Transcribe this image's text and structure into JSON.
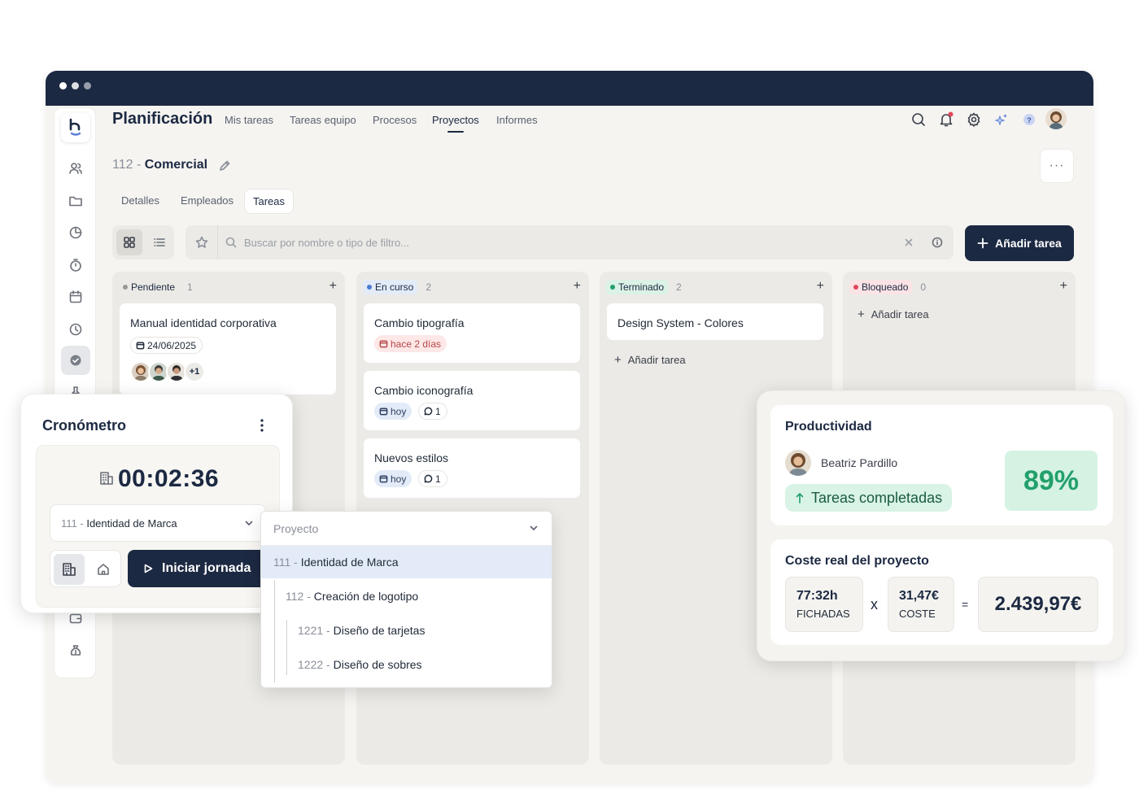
{
  "header": {
    "app_title": "Planificación",
    "nav": [
      "Mis tareas",
      "Tareas equipo",
      "Procesos",
      "Proyectos",
      "Informes"
    ],
    "active_nav": "Proyectos"
  },
  "project": {
    "number": "112",
    "separator": " - ",
    "name": "Comercial",
    "tabs": [
      "Detalles",
      "Empleados",
      "Tareas"
    ],
    "active_tab": "Tareas"
  },
  "search": {
    "placeholder": "Buscar por nombre o tipo de filtro..."
  },
  "add_task_button": "Añadir tarea",
  "columns": [
    {
      "status": "Pendiente",
      "color": "#9a9893",
      "chip_bg": "transparent",
      "count": "1",
      "add_label": ""
    },
    {
      "status": "En curso",
      "color": "#4a7bd0",
      "chip_bg": "#e3ebf8",
      "count": "2",
      "add_label": ""
    },
    {
      "status": "Terminado",
      "color": "#22a06b",
      "chip_bg": "#dbf2e6",
      "count": "2",
      "add_label": "Añadir tarea"
    },
    {
      "status": "Bloqueado",
      "color": "#e0485a",
      "chip_bg": "#fbe3e5",
      "count": "0",
      "add_label": "Añadir tarea"
    }
  ],
  "cards": {
    "pendiente": [
      {
        "title": "Manual identidad corporativa",
        "date": "24/06/2025",
        "extra_assignees": "+1"
      }
    ],
    "en_curso": [
      {
        "title": "Cambio tipografía",
        "due": "hace 2 días"
      },
      {
        "title": "Cambio iconografía",
        "due": "hoy",
        "comments": "1"
      },
      {
        "title": "Nuevos estilos",
        "due": "hoy",
        "comments": "1"
      }
    ],
    "terminado": [
      {
        "title": "Design System - Colores"
      }
    ]
  },
  "cronometro": {
    "title": "Cronómetro",
    "time": "00:02:36",
    "project_num": "111",
    "project_name": "Identidad de Marca",
    "start_button": "Iniciar jornada"
  },
  "dropdown": {
    "placeholder": "Proyecto",
    "items": [
      {
        "num": "111",
        "name": "Identidad de Marca",
        "level": 0,
        "selected": true
      },
      {
        "num": "112",
        "name": "Creación de logotipo",
        "level": 1,
        "selected": false
      },
      {
        "num": "1221",
        "name": "Diseño de tarjetas",
        "level": 2,
        "selected": false
      },
      {
        "num": "1222",
        "name": "Diseño de sobres",
        "level": 2,
        "selected": false
      }
    ]
  },
  "productividad": {
    "title": "Productividad",
    "user": "Beatriz Pardillo",
    "badge": "Tareas completadas",
    "percent": "89%"
  },
  "coste": {
    "title": "Coste real del proyecto",
    "hours": "77:32h",
    "hours_label": "FICHADAS",
    "rate": "31,47€",
    "rate_label": "COSTE",
    "times": "x",
    "equals": "=",
    "total": "2.439,97€"
  },
  "icons": {
    "sidebar": [
      "users-icon",
      "folder-icon",
      "pie-chart-icon",
      "timer-icon",
      "calendar-icon",
      "clock-history-icon",
      "check-circle-icon",
      "pin-icon",
      "wallet-icon",
      "money-bag-icon"
    ],
    "header": [
      "search-icon",
      "bell-icon",
      "gear-icon",
      "sparkles-icon",
      "help-icon",
      "avatar"
    ]
  },
  "colors": {
    "brand_navy": "#1c2942",
    "accent_green": "#22a06b",
    "notification_red": "#e0485a"
  }
}
